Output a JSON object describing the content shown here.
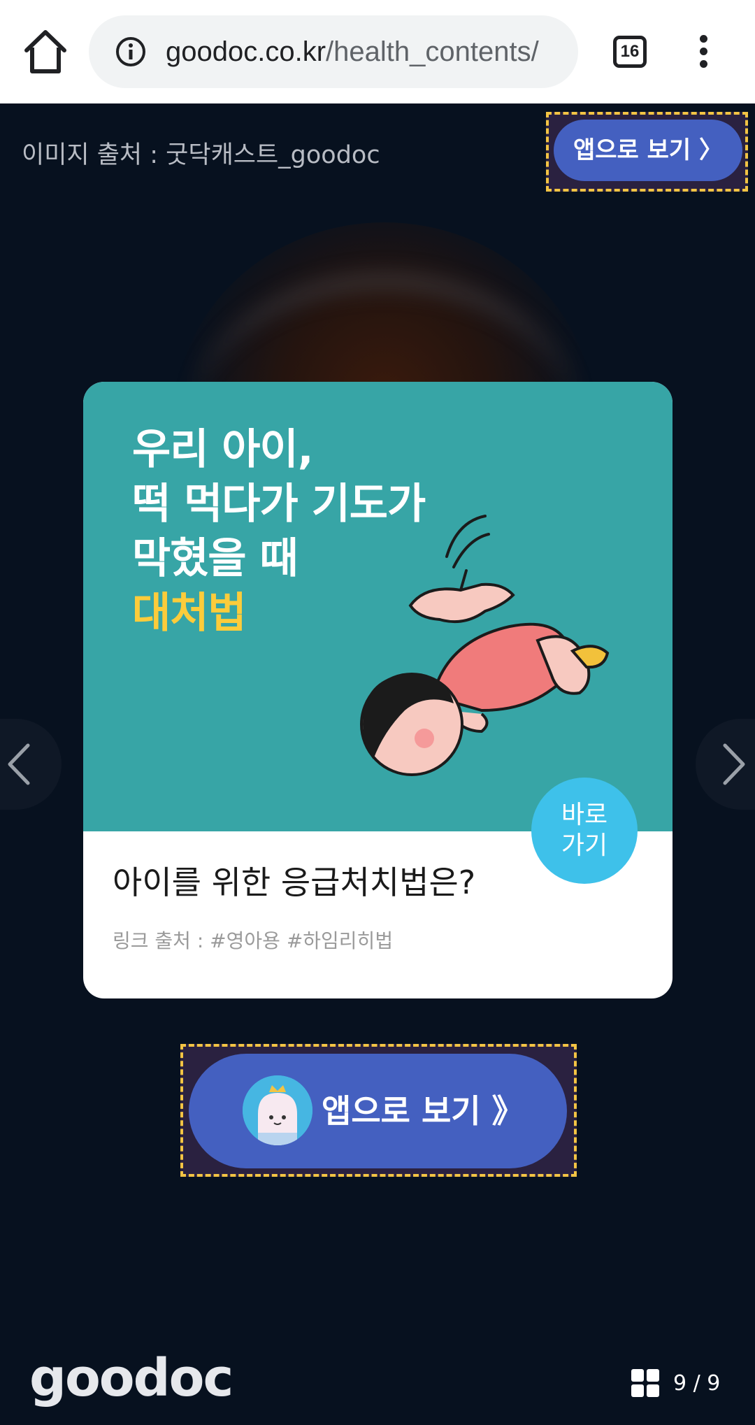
{
  "browser": {
    "url_domain": "goodoc.co.kr",
    "url_path": "/health_contents/",
    "tab_count": "16"
  },
  "content": {
    "image_source": "이미지 출처 : 굿닥캐스트_goodoc",
    "top_app_button": "앱으로 보기 〉"
  },
  "card": {
    "headline": [
      "우리 아이,",
      "떡 먹다가 기도가",
      "막혔을 때"
    ],
    "headline_accent": "대처법",
    "badge_line1": "바로",
    "badge_line2": "가기",
    "title": "아이를 위한 응급처치법은?",
    "link_source": "링크 출처 : #영아용 #하임리히법"
  },
  "bottom_app_button": {
    "label": "앱으로 보기 》"
  },
  "footer": {
    "logo": "goodoc",
    "pager": "9 / 9"
  },
  "colors": {
    "background": "#07111f",
    "card_teal": "#37a5a6",
    "accent_yellow": "#fccc3b",
    "app_button_blue": "#4460c0",
    "badge_blue": "#3ec1ea"
  },
  "icons": [
    "home-icon",
    "info-icon",
    "tabs-icon",
    "more-vert-icon",
    "chevron-left-icon",
    "chevron-right-icon",
    "grid-icon",
    "mascot-icon"
  ]
}
